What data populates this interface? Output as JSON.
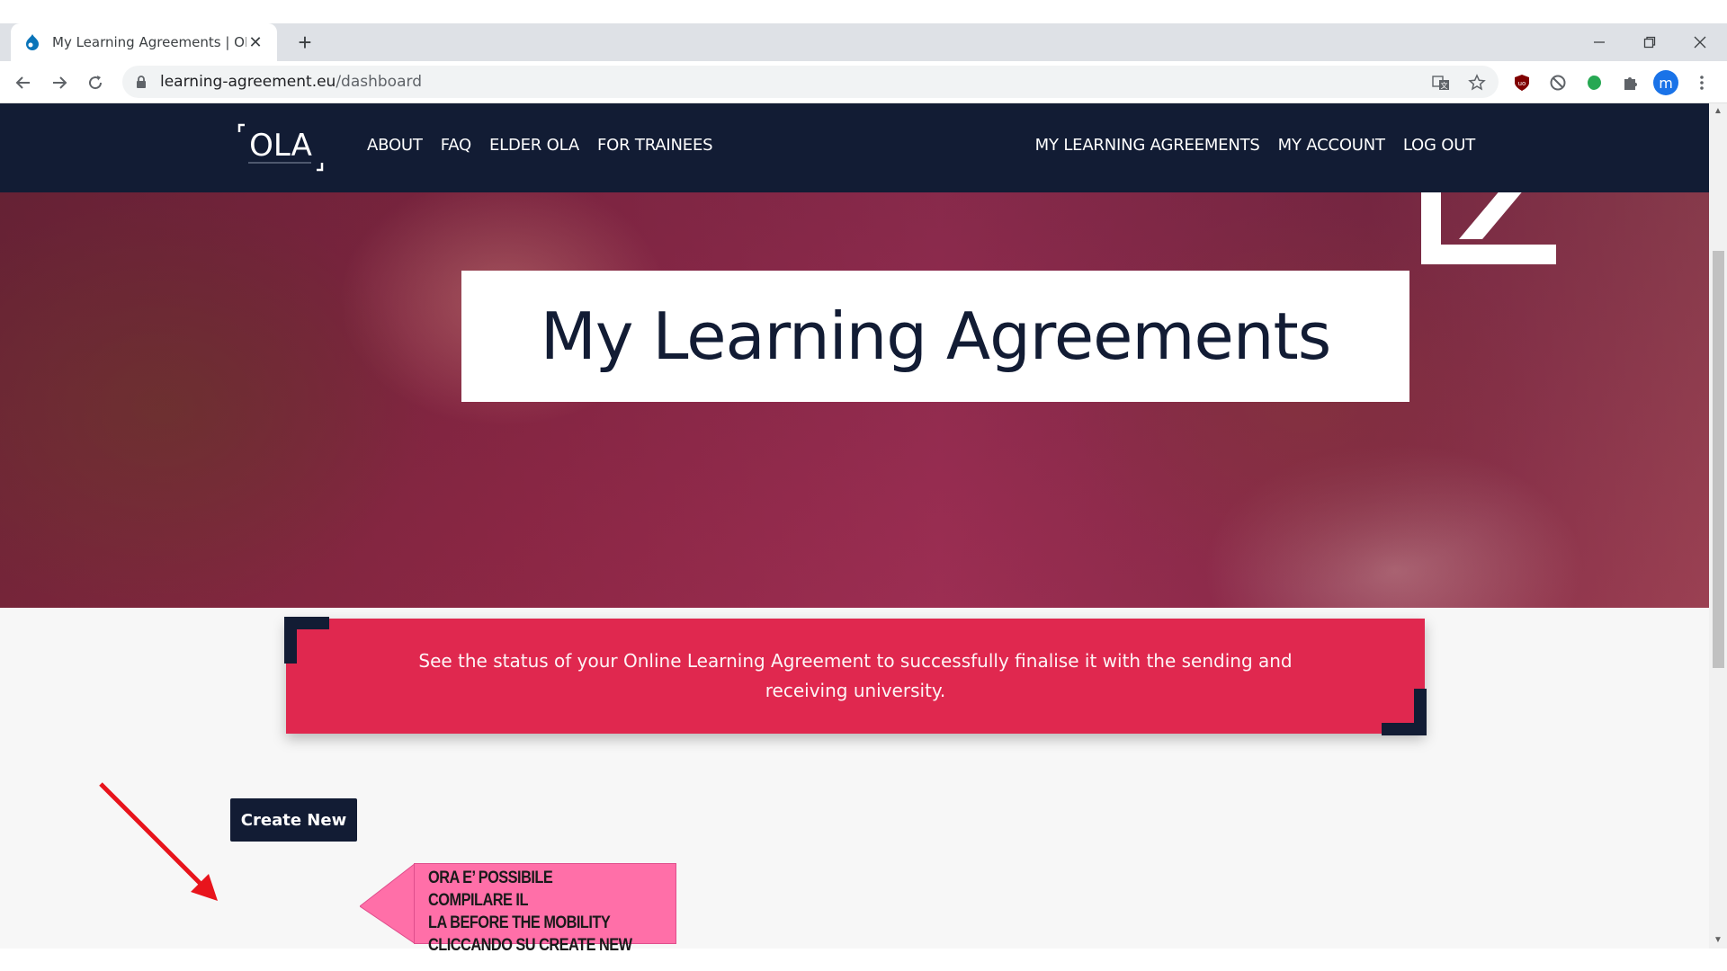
{
  "browser": {
    "tab_title": "My Learning Agreements | OLA",
    "url_host": "learning-agreement.eu",
    "url_path": "/dashboard",
    "profile_initial": "m"
  },
  "header": {
    "logo_text": "OLA",
    "nav_left": [
      "ABOUT",
      "FAQ",
      "ELDER OLA",
      "FOR TRAINEES"
    ],
    "nav_right": [
      "MY LEARNING AGREEMENTS",
      "MY ACCOUNT",
      "LOG OUT"
    ]
  },
  "hero": {
    "title": "My Learning Agreements"
  },
  "status_banner": {
    "text": "See the status of your Online Learning Agreement to successfully finalise it with the sending and receiving university."
  },
  "actions": {
    "create_new_label": "Create New"
  },
  "annotation": {
    "callout_lines": [
      "ORA E’ POSSIBILE COMPILARE IL",
      "LA BEFORE THE MOBILITY",
      "CLICCANDO SU CREATE NEW"
    ],
    "arrow_color": "#e8141c",
    "callout_color": "#ff6fa8"
  },
  "colors": {
    "navy": "#121c34",
    "banner_red": "#e0284f"
  }
}
